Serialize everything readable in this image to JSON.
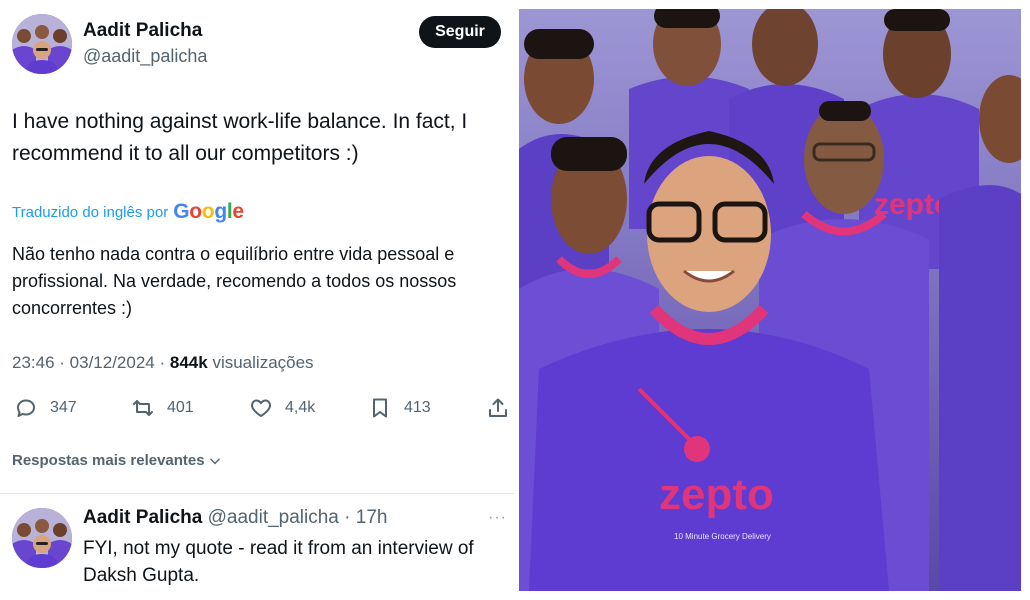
{
  "tweet": {
    "author_name": "Aadit Palicha",
    "author_handle": "@aadit_palicha",
    "follow_label": "Seguir",
    "text_line1": "I have nothing against work-life balance. In fact, I",
    "text_line2": "recommend it to all our competitors :)",
    "translated_by": "Traduzido do inglês por",
    "translation_line1": "Não tenho nada contra o equilíbrio entre vida pessoal e",
    "translation_line2": "profissional. Na verdade, recomendo a todos os nossos",
    "translation_line3": "concorrentes :)",
    "time": "23:46",
    "date": "03/12/2024",
    "views_count": "844k",
    "views_label": "visualizações",
    "replies": "347",
    "reposts": "401",
    "likes": "4,4k",
    "bookmarks": "413"
  },
  "replies_section": {
    "sort_label": "Respostas mais relevantes"
  },
  "reply": {
    "author_name": "Aadit Palicha",
    "author_handle": "@aadit_palicha",
    "time": "17h",
    "text_line1": "FYI, not my quote - read it from an interview of",
    "text_line2": "Daksh Gupta."
  },
  "photo": {
    "shirt_logo": "zepto",
    "shirt_tagline": "10 Minute Grocery Delivery"
  },
  "colors": {
    "link_blue": "#1d9bf0",
    "secondary_text": "#536471",
    "shirt_purple": "#5b3fc4",
    "collar_pink": "#e0357a"
  },
  "icons": [
    "reply-icon",
    "repost-icon",
    "like-icon",
    "bookmark-icon",
    "share-icon",
    "chevron-down-icon",
    "more-icon",
    "google-logo"
  ]
}
